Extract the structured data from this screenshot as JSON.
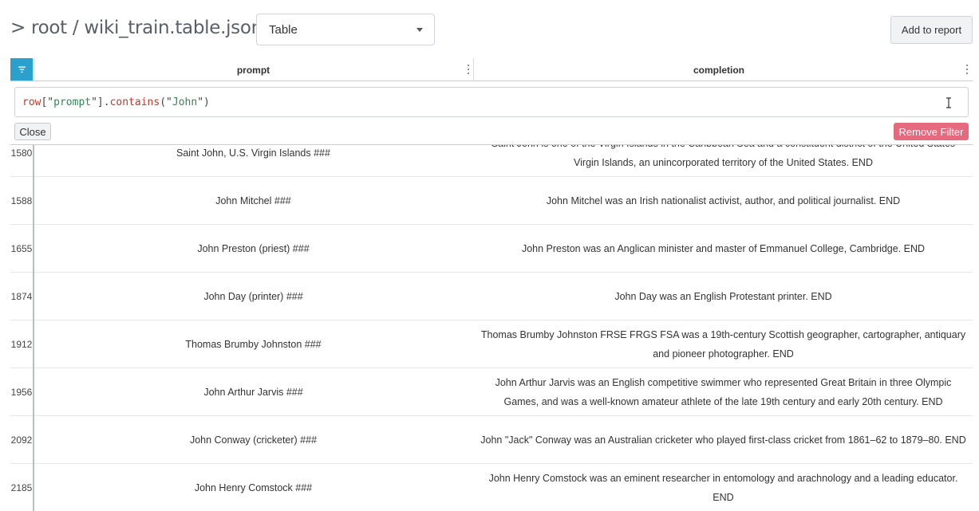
{
  "header": {
    "breadcrumb": "> root / wiki_train.table.json",
    "view_select": "Table",
    "add_to_report": "Add to report"
  },
  "columns": {
    "prompt": "prompt",
    "completion": "completion"
  },
  "filter": {
    "tokens": [
      "row",
      "[\"",
      "prompt",
      "\"].",
      "contains",
      "(\"",
      "John",
      "\")"
    ],
    "close_label": "Close",
    "remove_label": "Remove Filter"
  },
  "colors": {
    "filter_accent": "#2aa0cc",
    "remove_filter": "#e66a7d"
  },
  "rows": [
    {
      "index": "1580",
      "prompt": "Saint John, U.S. Virgin Islands ###",
      "completion": "Saint John is one of the Virgin Islands in the Caribbean Sea and a constituent district of the United States Virgin Islands, an unincorporated territory of the United States. END"
    },
    {
      "index": "1588",
      "prompt": "John Mitchel ###",
      "completion": "John Mitchel was an Irish nationalist activist, author, and political journalist. END"
    },
    {
      "index": "1655",
      "prompt": "John Preston (priest) ###",
      "completion": "John Preston was an Anglican minister and master of Emmanuel College, Cambridge. END"
    },
    {
      "index": "1874",
      "prompt": "John Day (printer) ###",
      "completion": "John Day was an English Protestant printer. END"
    },
    {
      "index": "1912",
      "prompt": "Thomas Brumby Johnston ###",
      "completion": "Thomas Brumby Johnston FRSE FRGS FSA was a 19th-century Scottish geographer, cartographer, antiquary and pioneer photographer. END"
    },
    {
      "index": "1956",
      "prompt": "John Arthur Jarvis ###",
      "completion": "John Arthur Jarvis was an English competitive swimmer who represented Great Britain in three Olympic Games, and was a well-known amateur athlete of the late 19th century and early 20th century. END"
    },
    {
      "index": "2092",
      "prompt": "John Conway (cricketer) ###",
      "completion": "John \"Jack\" Conway was an Australian cricketer who played first-class cricket from 1861–62 to 1879–80. END"
    },
    {
      "index": "2185",
      "prompt": "John Henry Comstock ###",
      "completion": "John Henry Comstock was an eminent researcher in entomology and arachnology and a leading educator. END"
    }
  ]
}
